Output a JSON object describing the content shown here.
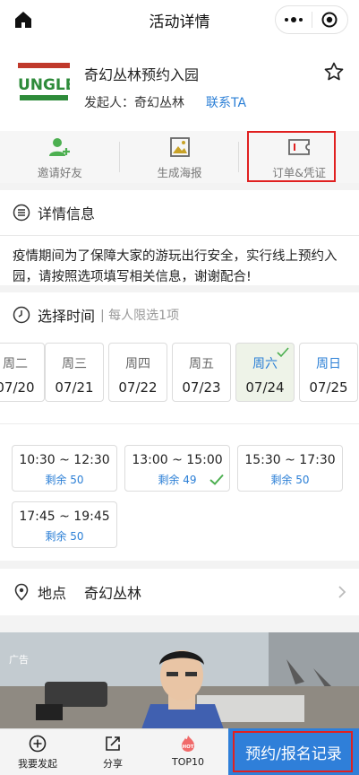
{
  "page": {
    "title": "活动详情"
  },
  "event": {
    "title": "奇幻丛林预约入园",
    "organizer_label": "发起人：奇幻丛林",
    "contact_label": "联系TA",
    "logo_text": "JUNGLE"
  },
  "actions": [
    {
      "label": "邀请好友",
      "icon": "invite-friend-icon"
    },
    {
      "label": "生成海报",
      "icon": "poster-icon"
    },
    {
      "label": "订单&凭证",
      "icon": "ticket-icon"
    }
  ],
  "details": {
    "heading": "详情信息",
    "text": "疫情期间为了保障大家的游玩出行安全，实行线上预约入园，请按照选项填写相关信息，谢谢配合!"
  },
  "schedule": {
    "heading": "选择时间",
    "note": "| 每人限选1项",
    "days": [
      {
        "weekday": "周二",
        "date": "07/20"
      },
      {
        "weekday": "周三",
        "date": "07/21"
      },
      {
        "weekday": "周四",
        "date": "07/22"
      },
      {
        "weekday": "周五",
        "date": "07/23"
      },
      {
        "weekday": "周六",
        "date": "07/24",
        "selected": true
      },
      {
        "weekday": "周日",
        "date": "07/25"
      }
    ],
    "slots": [
      {
        "time": "10:30 ~ 12:30",
        "remaining": "剩余 50"
      },
      {
        "time": "13:00 ~ 15:00",
        "remaining": "剩余 49",
        "selected": true
      },
      {
        "time": "15:30 ~ 17:30",
        "remaining": "剩余 50"
      },
      {
        "time": "17:45 ~ 19:45",
        "remaining": "剩余 50"
      }
    ]
  },
  "location": {
    "label": "地点",
    "value": "奇幻丛林"
  },
  "ad": {
    "label": "广告"
  },
  "tabbar": [
    {
      "label": "我要发起",
      "icon": "plus-circle-icon"
    },
    {
      "label": "分享",
      "icon": "share-icon"
    },
    {
      "label": "TOP10",
      "icon": "hot-icon",
      "badge": "HOT"
    }
  ],
  "cta": {
    "label": "预约/报名记录"
  },
  "colors": {
    "accent": "#2b7fd6",
    "cta": "#2f7fd9",
    "highlight": "#e02020",
    "green": "#4caf50"
  }
}
